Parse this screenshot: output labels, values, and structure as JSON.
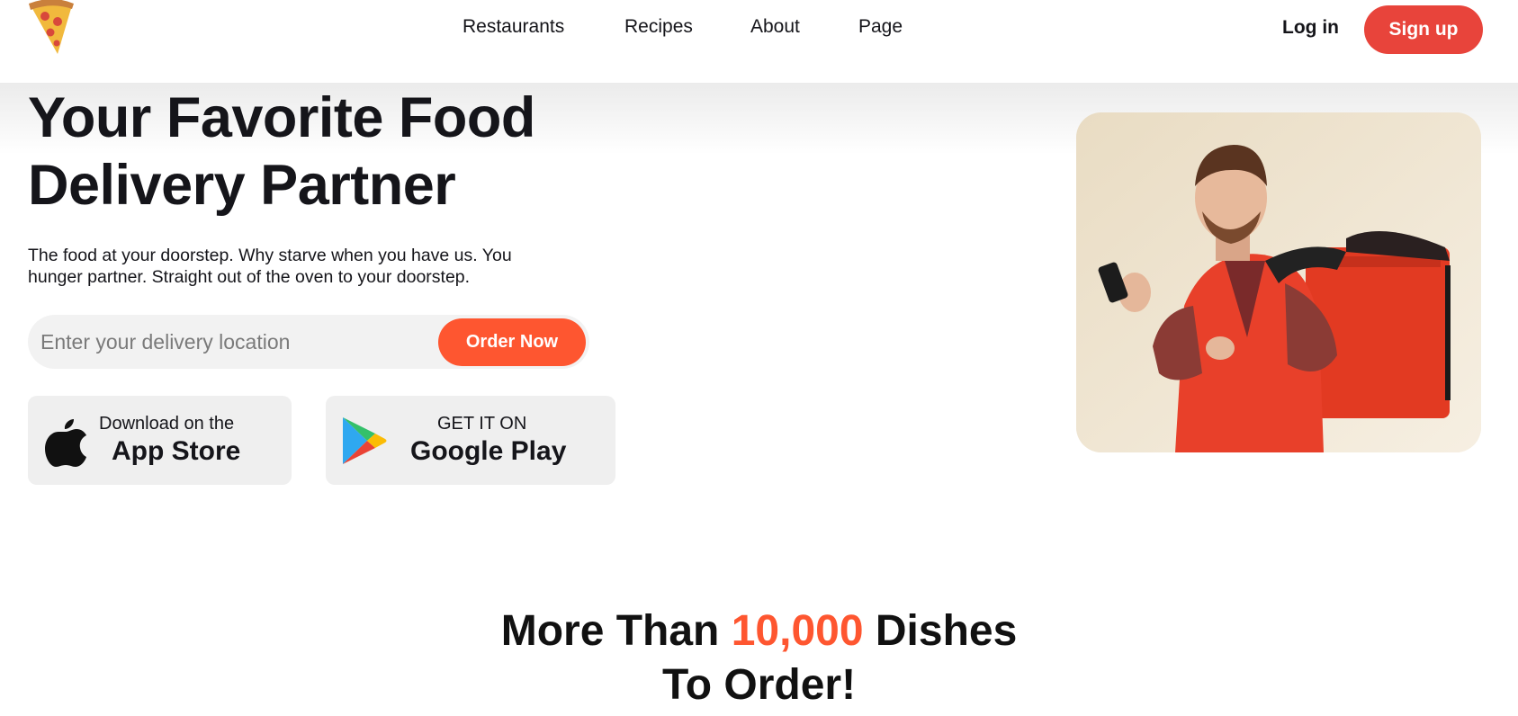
{
  "header": {
    "logo_icon": "pizza-slice-icon",
    "nav": [
      {
        "label": "Restaurants"
      },
      {
        "label": "Recipes"
      },
      {
        "label": "About"
      },
      {
        "label": "Page"
      }
    ],
    "login_label": "Log in",
    "signup_label": "Sign up"
  },
  "hero": {
    "title_line1": "Your Favorite Food",
    "title_line2": "Delivery Partner",
    "subtitle_line1": "The food at your doorstep. Why starve when you have us. You",
    "subtitle_line2": "hunger partner. Straight out of the oven to your doorstep.",
    "search_placeholder": "Enter your delivery location",
    "order_button_label": "Order Now",
    "app_store": {
      "small": "Download on the",
      "big": "App Store",
      "icon": "apple-icon"
    },
    "google_play": {
      "small": "GET IT ON",
      "big": "Google Play",
      "icon": "google-play-icon"
    },
    "image_alt": "Delivery courier with red backpack looking at phone"
  },
  "dishes": {
    "prefix": "More Than",
    "count": "10,000",
    "suffix": "Dishes",
    "line2": "To Order!"
  },
  "colors": {
    "accent": "#fe5630",
    "signup": "#e8443b",
    "card_bg": "#f3ead9"
  }
}
